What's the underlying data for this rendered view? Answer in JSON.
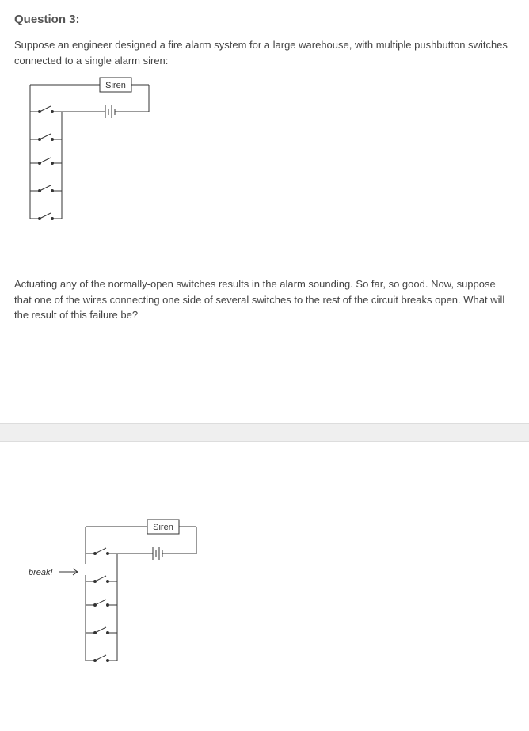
{
  "question": {
    "label": "Question 3:",
    "intro": "Suppose an engineer designed a fire alarm system for a large warehouse, with multiple pushbutton switches connected to a single alarm siren:",
    "mid": "Actuating any of the normally-open switches results in the alarm sounding. So far, so good. Now, suppose that one of the wires connecting one side of several switches to the rest of the circuit breaks open. What will the result of this failure be?"
  },
  "diagram1": {
    "siren_label": "Siren"
  },
  "diagram2": {
    "siren_label": "Siren",
    "break_label": "break!"
  }
}
